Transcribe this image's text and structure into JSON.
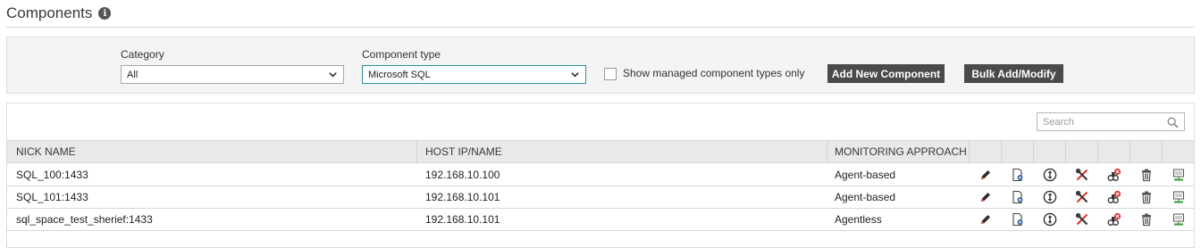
{
  "header": {
    "title": "Components",
    "info_glyph": "i"
  },
  "filters": {
    "category_label": "Category",
    "category_value": "All",
    "component_type_label": "Component type",
    "component_type_value": "Microsoft SQL",
    "managed_only_label": "Show managed component types only",
    "managed_only_checked": false,
    "add_new_label": "Add New Component",
    "bulk_label": "Bulk Add/Modify"
  },
  "search": {
    "placeholder": "Search"
  },
  "table": {
    "columns": [
      "NICK NAME",
      "HOST IP/NAME",
      "MONITORING APPROACH"
    ],
    "action_icons": [
      "edit-icon",
      "configure-icon",
      "move-icon",
      "tools-icon",
      "unmanage-icon",
      "delete-icon",
      "monitor-icon"
    ],
    "rows": [
      {
        "nick": "SQL_100:1433",
        "host": "192.168.10.100",
        "approach": "Agent-based"
      },
      {
        "nick": "SQL_101:1433",
        "host": "192.168.10.101",
        "approach": "Agent-based"
      },
      {
        "nick": "sql_space_test_sherief:1433",
        "host": "192.168.10.101",
        "approach": "Agentless"
      }
    ]
  },
  "colors": {
    "accent_focus": "#2f8f9d",
    "button_bg": "#4a4a4a",
    "icon_red": "#e0312b",
    "icon_green": "#3a9a3a"
  }
}
